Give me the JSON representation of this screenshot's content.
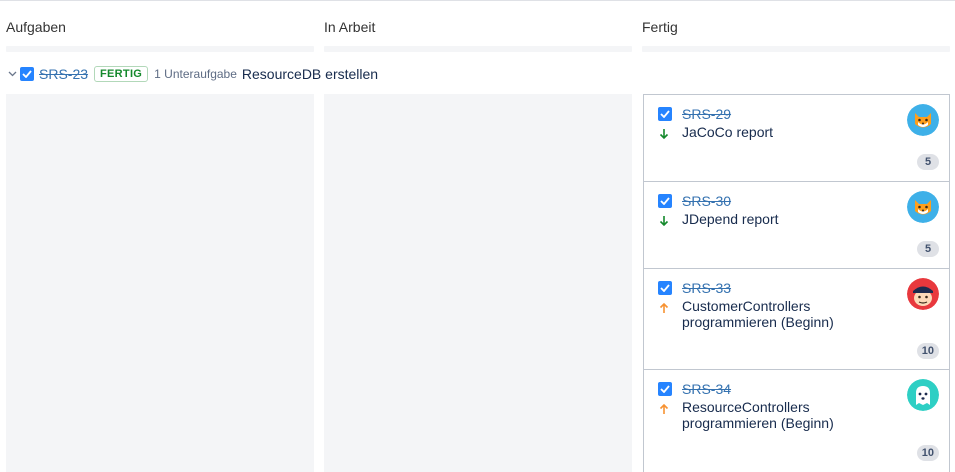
{
  "columns": [
    {
      "title": "Aufgaben"
    },
    {
      "title": "In Arbeit"
    },
    {
      "title": "Fertig"
    }
  ],
  "swimlane": {
    "key": "SRS-23",
    "status": "FERTIG",
    "subtasks": "1 Unteraufgabe",
    "title": "ResourceDB erstellen",
    "icon": "chevron-down-icon"
  },
  "cards": [
    {
      "key": "SRS-29",
      "summary": "JaCoCo report",
      "priority": "low",
      "priority_icon": "arrow-down-icon",
      "estimate": "5",
      "avatar": "fox-avatar"
    },
    {
      "key": "SRS-30",
      "summary": "JDepend report",
      "priority": "low",
      "priority_icon": "arrow-down-icon",
      "estimate": "5",
      "avatar": "fox-avatar"
    },
    {
      "key": "SRS-33",
      "summary": "CustomerControllers programmieren (Beginn)",
      "priority": "high",
      "priority_icon": "arrow-up-icon",
      "estimate": "10",
      "avatar": "pirate-avatar"
    },
    {
      "key": "SRS-34",
      "summary": "ResourceControllers programmieren (Beginn)",
      "priority": "high",
      "priority_icon": "arrow-up-icon",
      "estimate": "10",
      "avatar": "ghost-avatar"
    }
  ],
  "colors": {
    "accent": "#2684ff",
    "link": "#3572b0",
    "done_green": "#14892c",
    "priority_low": "#14892c",
    "priority_high": "#f79232"
  }
}
